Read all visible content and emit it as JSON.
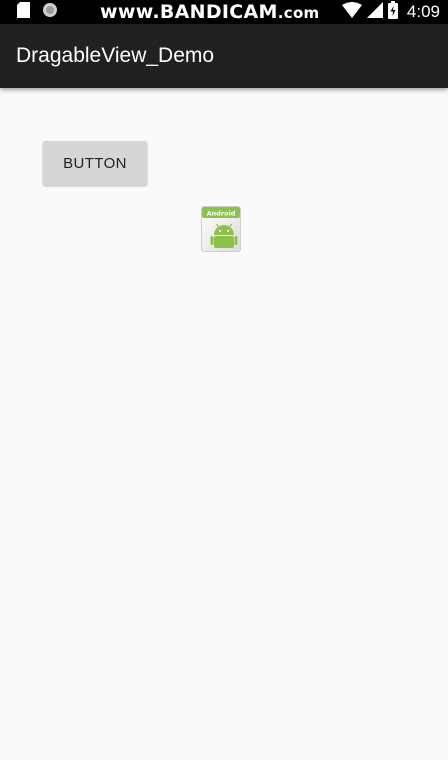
{
  "status_bar": {
    "watermark_main": "www.BANDICAM",
    "watermark_suffix": ".com",
    "time": "4:09",
    "icons": [
      "sd-card-icon",
      "circle-notification-icon",
      "wifi-icon",
      "signal-icon",
      "battery-icon"
    ]
  },
  "app_bar": {
    "title": "DragableView_Demo",
    "background": "#212121"
  },
  "content": {
    "button_label": "BUTTON",
    "draggable_icon": {
      "name": "android-logo-icon",
      "label": "Android",
      "color": "#8bc34a"
    },
    "background": "#fafafa"
  }
}
